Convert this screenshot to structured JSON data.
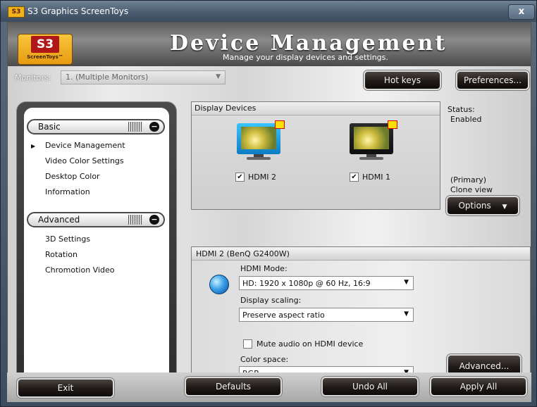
{
  "window": {
    "title": "S3 Graphics ScreenToys",
    "title_logo": "S3",
    "close_glyph": "x"
  },
  "header": {
    "logo_mark": "S3",
    "logo_sub": "ScreenToys™",
    "title": "Device Management",
    "subtitle": "Manage your display devices and settings."
  },
  "monitors": {
    "label": "Monitors:",
    "selected": "1. (Multiple Monitors)"
  },
  "toolbar": {
    "hotkeys_label": "Hot keys",
    "preferences_label": "Preferences..."
  },
  "nav": {
    "basic": {
      "label": "Basic",
      "items": [
        "Device Management",
        "Video Color Settings",
        "Desktop Color",
        "Information"
      ]
    },
    "advanced": {
      "label": "Advanced",
      "items": [
        "3D Settings",
        "Rotation",
        "Chromotion Video"
      ]
    }
  },
  "devices": {
    "title": "Display Devices",
    "hdmi2_label": "HDMI 2",
    "hdmi1_label": "HDMI 1"
  },
  "status": {
    "title": "Status:",
    "value": "Enabled",
    "primary": "(Primary)",
    "clone": "Clone view",
    "options_label": "Options"
  },
  "hdmi": {
    "title": "HDMI 2 (BenQ G2400W)",
    "mode_label": "HDMI Mode:",
    "mode_value": "HD: 1920 x 1080p @ 60 Hz, 16:9",
    "scaling_label": "Display scaling:",
    "scaling_value": "Preserve aspect ratio",
    "mute_label": "Mute audio on HDMI device",
    "color_label": "Color space:",
    "color_value": "RGB",
    "advanced_label": "Advanced..."
  },
  "footer": {
    "exit_label": "Exit",
    "defaults_label": "Defaults",
    "undo_label": "Undo All",
    "apply_label": "Apply All"
  },
  "colors": {
    "accent_button_bg": "#1f1a17",
    "primary_monitor": "#1b9ae0",
    "logo_yellow": "#f2b21c"
  }
}
